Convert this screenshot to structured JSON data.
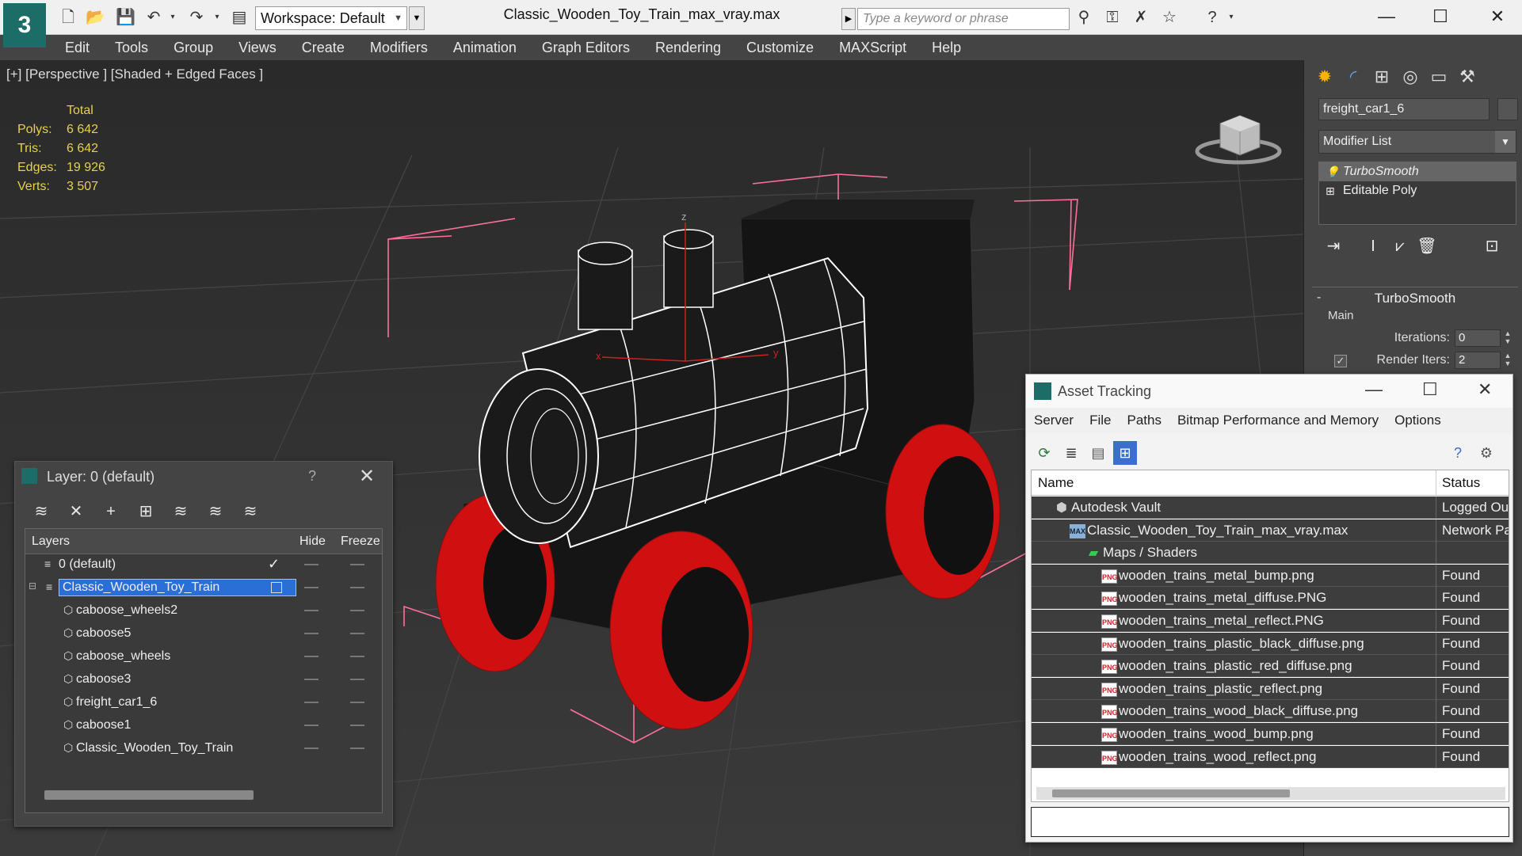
{
  "titlebar": {
    "workspace_label": "Workspace: Default",
    "document_title": "Classic_Wooden_Toy_Train_max_vray.max",
    "search_placeholder": "Type a keyword or phrase"
  },
  "menu": [
    "Edit",
    "Tools",
    "Group",
    "Views",
    "Create",
    "Modifiers",
    "Animation",
    "Graph Editors",
    "Rendering",
    "Customize",
    "MAXScript",
    "Help"
  ],
  "viewport": {
    "label": "[+] [Perspective ] [Shaded + Edged Faces ]",
    "stats_header": "Total",
    "stats": [
      {
        "label": "Polys:",
        "value": "6 642"
      },
      {
        "label": "Tris:",
        "value": "6 642"
      },
      {
        "label": "Edges:",
        "value": "19 926"
      },
      {
        "label": "Verts:",
        "value": "3 507"
      }
    ],
    "axis_labels": {
      "z": "z",
      "x": "x",
      "y": "y"
    }
  },
  "command_panel": {
    "object_name": "freight_car1_6",
    "modifier_list_label": "Modifier List",
    "stack": [
      {
        "label": "TurboSmooth",
        "selected": true
      },
      {
        "label": "Editable Poly",
        "selected": false
      }
    ],
    "rollout_title": "TurboSmooth",
    "group_main": "Main",
    "iterations_label": "Iterations:",
    "iterations_value": "0",
    "render_iters_label": "Render Iters:",
    "render_iters_value": "2"
  },
  "layer_dialog": {
    "title": "Layer: 0 (default)",
    "help": "?",
    "columns": {
      "layers": "Layers",
      "hide": "Hide",
      "freeze": "Freeze"
    },
    "rows": [
      {
        "name": "0 (default)",
        "level": 0,
        "type": "layer"
      },
      {
        "name": "Classic_Wooden_Toy_Train",
        "level": 0,
        "type": "layer",
        "selected": true
      },
      {
        "name": "caboose_wheels2",
        "level": 1,
        "type": "object"
      },
      {
        "name": "caboose5",
        "level": 1,
        "type": "object"
      },
      {
        "name": "caboose_wheels",
        "level": 1,
        "type": "object"
      },
      {
        "name": "caboose3",
        "level": 1,
        "type": "object"
      },
      {
        "name": "freight_car1_6",
        "level": 1,
        "type": "object"
      },
      {
        "name": "caboose1",
        "level": 1,
        "type": "object"
      },
      {
        "name": "Classic_Wooden_Toy_Train",
        "level": 1,
        "type": "object"
      }
    ]
  },
  "asset_dialog": {
    "title": "Asset Tracking",
    "menu": [
      "Server",
      "File",
      "Paths",
      "Bitmap Performance and Memory",
      "Options"
    ],
    "columns": {
      "name": "Name",
      "status": "Status"
    },
    "rows": [
      {
        "name": "Autodesk Vault",
        "status": "Logged Ou",
        "indent": 50,
        "icon": "vault"
      },
      {
        "name": "Classic_Wooden_Toy_Train_max_vray.max",
        "status": "Network Pa",
        "indent": 70,
        "icon": "max"
      },
      {
        "name": "Maps / Shaders",
        "status": "",
        "indent": 90,
        "icon": "map"
      },
      {
        "name": "wooden_trains_metal_bump.png",
        "status": "Found",
        "indent": 110,
        "icon": "png"
      },
      {
        "name": "wooden_trains_metal_diffuse.PNG",
        "status": "Found",
        "indent": 110,
        "icon": "png"
      },
      {
        "name": "wooden_trains_metal_reflect.PNG",
        "status": "Found",
        "indent": 110,
        "icon": "png"
      },
      {
        "name": "wooden_trains_plastic_black_diffuse.png",
        "status": "Found",
        "indent": 110,
        "icon": "png"
      },
      {
        "name": "wooden_trains_plastic_red_diffuse.png",
        "status": "Found",
        "indent": 110,
        "icon": "png"
      },
      {
        "name": "wooden_trains_plastic_reflect.png",
        "status": "Found",
        "indent": 110,
        "icon": "png"
      },
      {
        "name": "wooden_trains_wood_black_diffuse.png",
        "status": "Found",
        "indent": 110,
        "icon": "png"
      },
      {
        "name": "wooden_trains_wood_bump.png",
        "status": "Found",
        "indent": 110,
        "icon": "png"
      },
      {
        "name": "wooden_trains_wood_reflect.png",
        "status": "Found",
        "indent": 110,
        "icon": "png"
      }
    ]
  },
  "colors": {
    "accent": "#1c6d68",
    "selection": "#2a6fd6",
    "wheel_red": "#d01010",
    "stats_yellow": "#e6d24a",
    "bbox_pink": "#ff6f9a"
  }
}
